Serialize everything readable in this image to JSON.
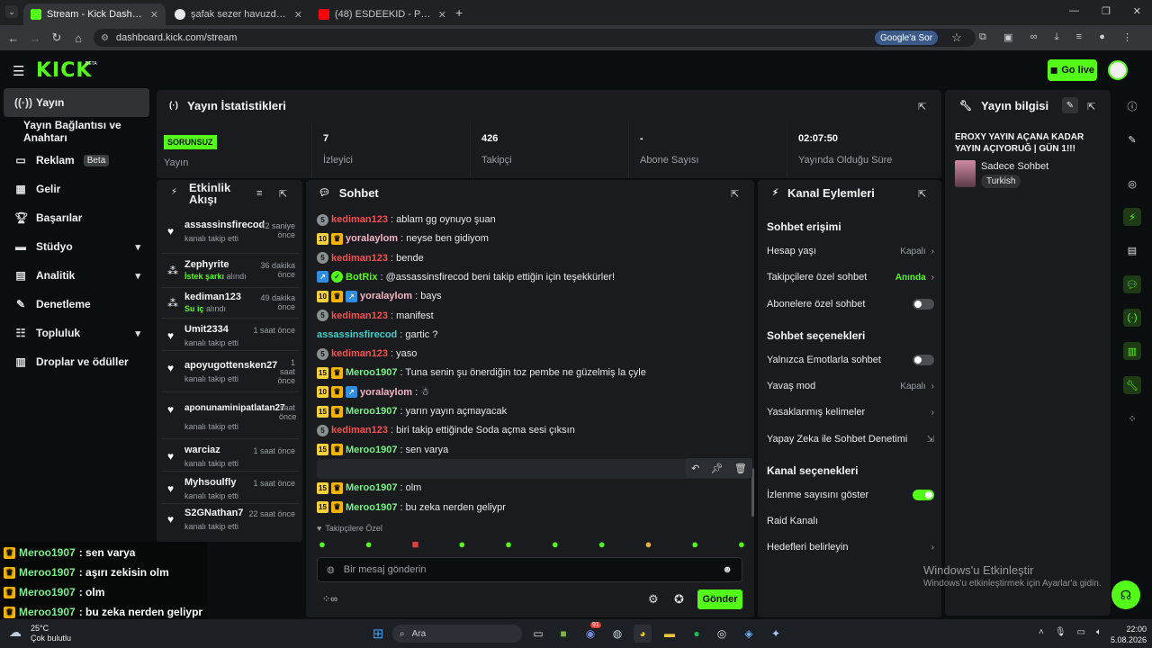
{
  "browser": {
    "tabs": [
      {
        "title": "Stream - Kick Dashboard",
        "color": "#53fc18"
      },
      {
        "title": "şafak sezer havuzda faruk - Goo",
        "color": "#4285f4"
      },
      {
        "title": "(48) ESDEEKID - PHANTOM (SLO",
        "color": "#ff0000"
      }
    ],
    "new_tab": "+",
    "url": "dashboard.kick.com/stream",
    "google_sor": "Google'a Sor"
  },
  "kick": {
    "logo": "KICK",
    "logo_beta": "BETA",
    "go_live": "Go live",
    "accent": "#53fc18"
  },
  "sidebar": {
    "items": [
      {
        "label": "Yayın",
        "icon": "broadcast-icon"
      },
      {
        "label": "Yayın Bağlantısı ve Anahtarı",
        "icon": ""
      },
      {
        "label": "Reklam",
        "icon": "ad-icon",
        "badge": "Beta"
      },
      {
        "label": "Gelir",
        "icon": "revenue-icon"
      },
      {
        "label": "Başarılar",
        "icon": "trophy-icon"
      },
      {
        "label": "Stüdyo",
        "icon": "studio-icon"
      },
      {
        "label": "Analitik",
        "icon": "analytics-icon"
      },
      {
        "label": "Denetleme",
        "icon": "moderation-icon"
      },
      {
        "label": "Topluluk",
        "icon": "community-icon"
      },
      {
        "label": "Droplar ve ödüller",
        "icon": "drops-icon"
      }
    ]
  },
  "stats": {
    "title": "Yayın İstatistikleri",
    "status_badge": "SORUNSUZ",
    "status_label": "Yayın",
    "items": [
      {
        "value": "7",
        "label": "İzleyici"
      },
      {
        "value": "426",
        "label": "Takipçi"
      },
      {
        "value": "-",
        "label": "Abone Sayısı"
      },
      {
        "value": "02:07:50",
        "label": "Yayında Olduğu Süre"
      }
    ]
  },
  "stream_info": {
    "title": "Yayın bilgisi",
    "stream_title": "EROXY YAYIN AÇANA KADAR YAYIN AÇIYORUĞ | GÜN 1!!!",
    "category": "Sadece Sohbet",
    "tag": "Turkish"
  },
  "activity": {
    "title_line1": "Etkinlik",
    "title_line2": "Akışı",
    "items": [
      {
        "name": "assassinsfirecod",
        "sub": "kanalı takip etti",
        "time": "42 saniye önce",
        "icon": "heart-icon"
      },
      {
        "name": "Zephyrite",
        "sub_green": "İstek şarkı",
        "sub": "alındı",
        "time": "36 dakika önce",
        "icon": "reward-icon"
      },
      {
        "name": "kediman123",
        "sub_green": "Su iç",
        "sub": "alındı",
        "time": "49 dakika önce",
        "icon": "reward-icon"
      },
      {
        "name": "Umit2334",
        "sub": "kanalı takip etti",
        "time": "1 saat önce",
        "icon": "heart-icon"
      },
      {
        "name": "apoyugottensken27",
        "sub": "kanalı takip etti",
        "time": "1 saat önce",
        "icon": "heart-icon"
      },
      {
        "name": "aponunaminipatlatan27",
        "sub": "kanalı takip etti",
        "time": "saat önce",
        "icon": "heart-icon"
      },
      {
        "name": "warciaz",
        "sub": "kanalı takip etti",
        "time": "1 saat önce",
        "icon": "heart-icon"
      },
      {
        "name": "Myhsoulfly",
        "sub": "kanalı takip etti",
        "time": "1 saat önce",
        "icon": "heart-icon"
      },
      {
        "name": "S2GNathan7",
        "sub": "kanalı takip etti",
        "time": "22 saat önce",
        "icon": "heart-icon"
      }
    ]
  },
  "chat": {
    "title": "Sohbet",
    "messages": [
      {
        "badges": [
          "5"
        ],
        "user": "kediman123",
        "color": "#ff4d4d",
        "text": ": ablam gg oynuyo şuan"
      },
      {
        "badges": [
          "10",
          "crown"
        ],
        "user": "yoralaylom",
        "color": "#f4b6c2",
        "text": ": neyse ben gidiyom"
      },
      {
        "badges": [
          "5"
        ],
        "user": "kediman123",
        "color": "#ff4d4d",
        "text": ": bende"
      },
      {
        "badges": [
          "vip",
          "bot"
        ],
        "user": "BotRix",
        "color": "#53fc18",
        "text": ": @assassinsfirecod beni takip ettiğin için teşekkürler!"
      },
      {
        "badges": [
          "10",
          "crown",
          "vip"
        ],
        "user": "yoralaylom",
        "color": "#f4b6c2",
        "text": ": bays"
      },
      {
        "badges": [
          "5"
        ],
        "user": "kediman123",
        "color": "#ff4d4d",
        "text": ": manifest"
      },
      {
        "badges": [],
        "user": "assassinsfirecod",
        "color": "#3fd0c9",
        "text": ": gartic ?"
      },
      {
        "badges": [
          "5"
        ],
        "user": "kediman123",
        "color": "#ff4d4d",
        "text": ": yaso"
      },
      {
        "badges": [
          "15",
          "crown"
        ],
        "user": "Meroo1907",
        "color": "#7bf08a",
        "text": ": Tuna senin şu önerdiğin toz pembe ne güzelmiş la çyle"
      },
      {
        "badges": [
          "10",
          "crown",
          "vip"
        ],
        "user": "yoralaylom",
        "color": "#f4b6c2",
        "text": ": ☃"
      },
      {
        "badges": [
          "15",
          "crown"
        ],
        "user": "Meroo1907",
        "color": "#7bf08a",
        "text": ": yarın yayın açmayacak"
      },
      {
        "badges": [
          "5"
        ],
        "user": "kediman123",
        "color": "#ff4d4d",
        "text": ": biri takip ettiğinde Soda açma sesi çıksın"
      },
      {
        "badges": [
          "15",
          "crown"
        ],
        "user": "Meroo1907",
        "color": "#7bf08a",
        "text": ": sen varya"
      },
      {
        "badges": [
          "15",
          "crown"
        ],
        "user": "Meroo1907",
        "color": "#7bf08a",
        "text": ": aşırı zekisin olm"
      },
      {
        "badges": [
          "15",
          "crown"
        ],
        "user": "Meroo1907",
        "color": "#7bf08a",
        "text": ": olm"
      },
      {
        "badges": [
          "15",
          "crown"
        ],
        "user": "Meroo1907",
        "color": "#7bf08a",
        "text": ": bu zeka nerden geliypr"
      }
    ],
    "followers_only": "Takipçilere Özel",
    "input_placeholder": "Bir mesaj gönderin",
    "send": "Gönder"
  },
  "channel_actions": {
    "title": "Kanal Eylemleri",
    "chat_access": "Sohbet erişimi",
    "account_age": {
      "label": "Hesap yaşı",
      "value": "Kapalı"
    },
    "followers_chat": {
      "label": "Takipçilere özel sohbet",
      "value": "Anında"
    },
    "subs_chat": "Abonelere özel sohbet",
    "chat_options": "Sohbet seçenekleri",
    "emotes_only": "Yalnızca Emotlarla sohbet",
    "slow_mode": {
      "label": "Yavaş mod",
      "value": "Kapalı"
    },
    "banned_words": "Yasaklanmış kelimeler",
    "ai_moderation": "Yapay Zeka ile Sohbet Denetimi",
    "channel_options": "Kanal seçenekleri",
    "show_viewers": "İzlenme sayısını göster",
    "raid": "Raid Kanalı",
    "goals": "Hedefleri belirleyin"
  },
  "overlay_chat": [
    {
      "user": "Meroo1907",
      "text": ": sen varya"
    },
    {
      "user": "Meroo1907",
      "text": ": aşırı zekisin olm"
    },
    {
      "user": "Meroo1907",
      "text": ": olm"
    },
    {
      "user": "Meroo1907",
      "text": ": bu zeka nerden geliypr"
    }
  ],
  "windows": {
    "activate_title": "Windows'u Etkinleştir",
    "activate_sub": "Windows'u etkinleştirmek için Ayarlar'a gidin.",
    "weather_temp": "25°C",
    "weather_desc": "Çok bulutlu",
    "search": "Ara",
    "time": "22:00",
    "date": "5.08.2026",
    "notif_count": "91"
  }
}
